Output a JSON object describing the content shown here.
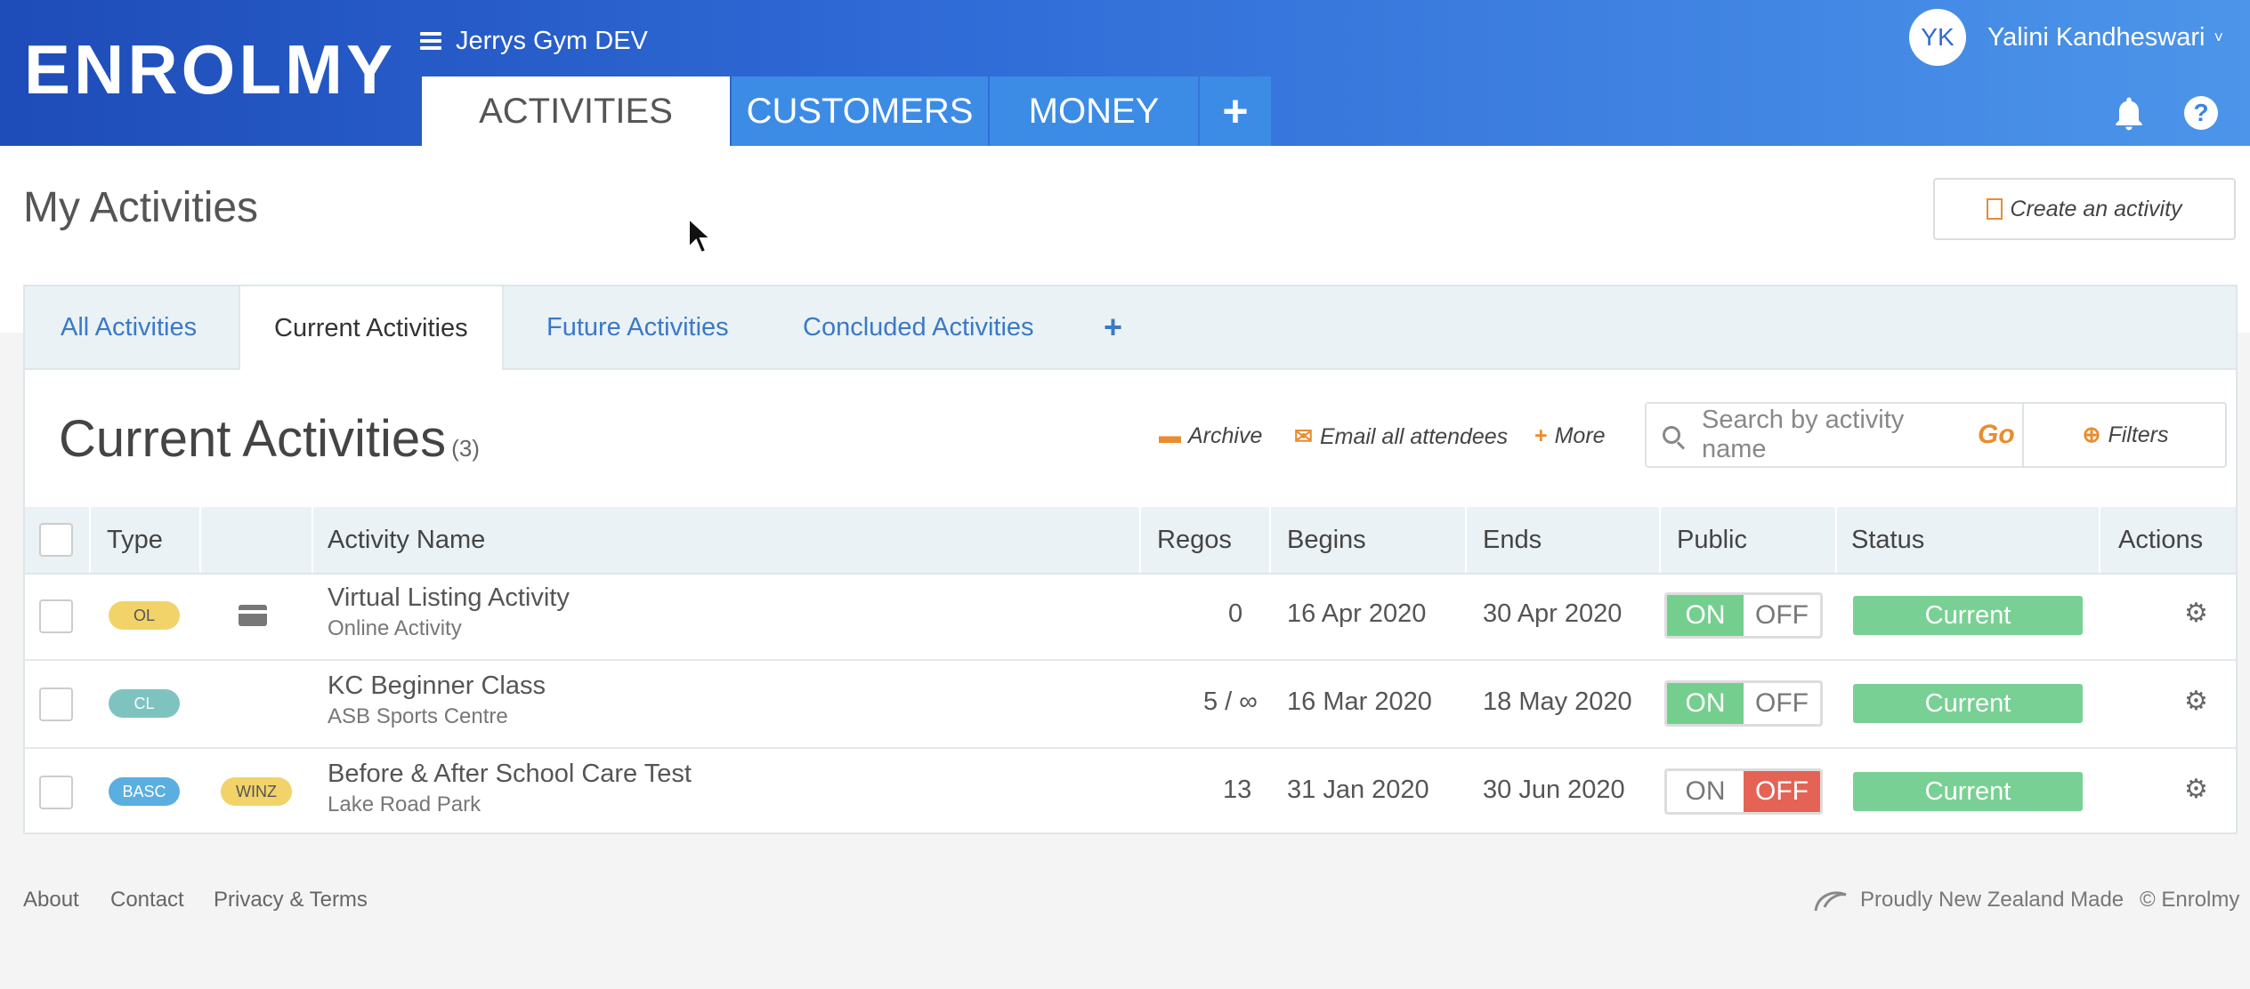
{
  "header": {
    "logo": "ENROLMY",
    "org_name": "Jerrys Gym DEV",
    "tabs": [
      {
        "label": "ACTIVITIES",
        "active": true
      },
      {
        "label": "CUSTOMERS",
        "active": false
      },
      {
        "label": "MONEY",
        "active": false
      },
      {
        "label": "+",
        "active": false
      }
    ],
    "user": {
      "initials": "YK",
      "name": "Yalini Kandheswari",
      "caret": "˅"
    },
    "icons": [
      "bell-icon",
      "help-icon"
    ],
    "help_glyph": "?"
  },
  "page": {
    "title": "My Activities",
    "create_button": "Create an activity"
  },
  "subtabs": [
    {
      "label": "All Activities",
      "active": false
    },
    {
      "label": "Current Activities",
      "active": true
    },
    {
      "label": "Future Activities",
      "active": false
    },
    {
      "label": "Concluded Activities",
      "active": false
    },
    {
      "label": "+",
      "active": false
    }
  ],
  "section": {
    "title": "Current Activities",
    "count": "(3)",
    "archive": "Archive",
    "email": "Email all attendees",
    "more": "More",
    "search_placeholder": "Search by activity name",
    "go": "Go",
    "filters": "Filters"
  },
  "table": {
    "columns": [
      "Type",
      "Activity Name",
      "Regos",
      "Begins",
      "Ends",
      "Public",
      "Status",
      "Actions"
    ],
    "rows": [
      {
        "type": "OL",
        "type_color": "#f1d36a",
        "type_text_color": "#555",
        "extra_icon": "credit-card-icon",
        "extra_badge": "",
        "name": "Virtual Listing Activity",
        "location": "Online Activity",
        "regos": "0",
        "begins": "16 Apr 2020",
        "ends": "30 Apr 2020",
        "on": "ON",
        "off": "OFF",
        "public": "on",
        "status": "Current"
      },
      {
        "type": "CL",
        "type_color": "#7fc3c0",
        "type_text_color": "#fff",
        "extra_icon": "",
        "extra_badge": "",
        "name": "KC Beginner Class",
        "location": "ASB Sports Centre",
        "regos": "5 / ∞",
        "begins": "16 Mar 2020",
        "ends": "18 May 2020",
        "on": "ON",
        "off": "OFF",
        "public": "on",
        "status": "Current"
      },
      {
        "type": "BASC",
        "type_color": "#5aaee0",
        "type_text_color": "#fff",
        "extra_icon": "",
        "extra_badge": "WINZ",
        "name": "Before & After School Care Test",
        "location": "Lake Road Park",
        "regos": "13",
        "begins": "31 Jan 2020",
        "ends": "30 Jun 2020",
        "on": "ON",
        "off": "OFF",
        "public": "off",
        "status": "Current"
      }
    ]
  },
  "footer": {
    "links": [
      "About",
      "Contact",
      "Privacy & Terms"
    ],
    "nz_made": "Proudly New Zealand Made",
    "copyright": "© Enrolmy"
  },
  "colors": {
    "accent": "#2f6ad6",
    "orange": "#e98d2f",
    "green": "#74cf8f",
    "red": "#e46355"
  }
}
